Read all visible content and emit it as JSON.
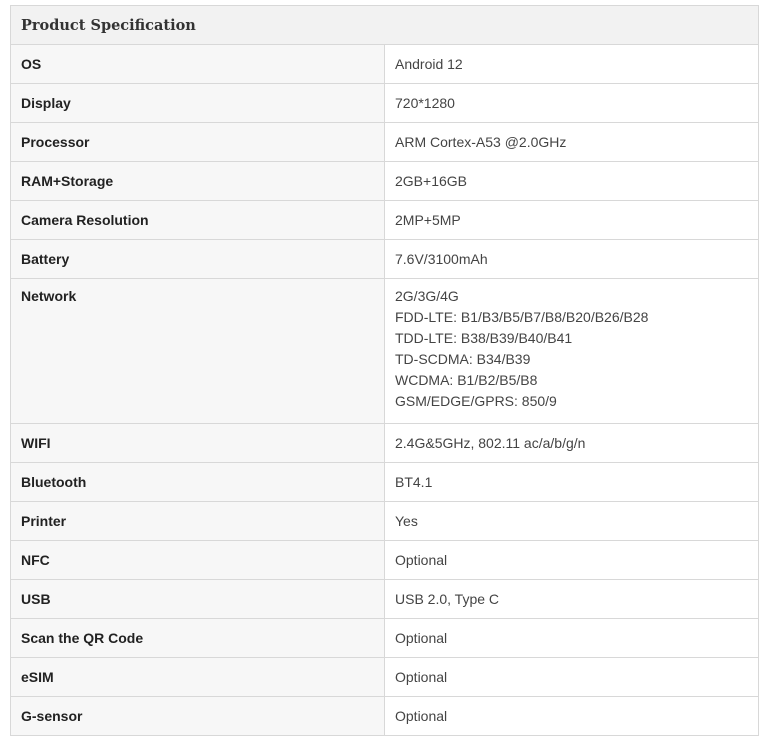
{
  "title": "Product Specification",
  "rows": [
    {
      "key": "OS",
      "value": "Android 12"
    },
    {
      "key": "Display",
      "value": "720*1280"
    },
    {
      "key": "Processor",
      "value": "ARM Cortex-A53 @2.0GHz"
    },
    {
      "key": "RAM+Storage",
      "value": "2GB+16GB"
    },
    {
      "key": "Camera Resolution",
      "value": "2MP+5MP"
    },
    {
      "key": "Battery",
      "value": "7.6V/3100mAh"
    },
    {
      "key": "Network",
      "lines": [
        "2G/3G/4G",
        "FDD-LTE: B1/B3/B5/B7/B8/B20/B26/B28",
        "TDD-LTE: B38/B39/B40/B41",
        "TD-SCDMA: B34/B39",
        "WCDMA: B1/B2/B5/B8",
        "GSM/EDGE/GPRS: 850/9"
      ]
    },
    {
      "key": "WIFI",
      "value": "2.4G&5GHz, 802.11 ac/a/b/g/n"
    },
    {
      "key": "Bluetooth",
      "value": "BT4.1"
    },
    {
      "key": "Printer",
      "value": "Yes"
    },
    {
      "key": "NFC",
      "value": "Optional"
    },
    {
      "key": "USB",
      "value": "USB 2.0, Type C"
    },
    {
      "key": "Scan the QR Code",
      "value": "Optional"
    },
    {
      "key": "eSIM",
      "value": "Optional"
    },
    {
      "key": "G-sensor",
      "value": "Optional"
    }
  ]
}
